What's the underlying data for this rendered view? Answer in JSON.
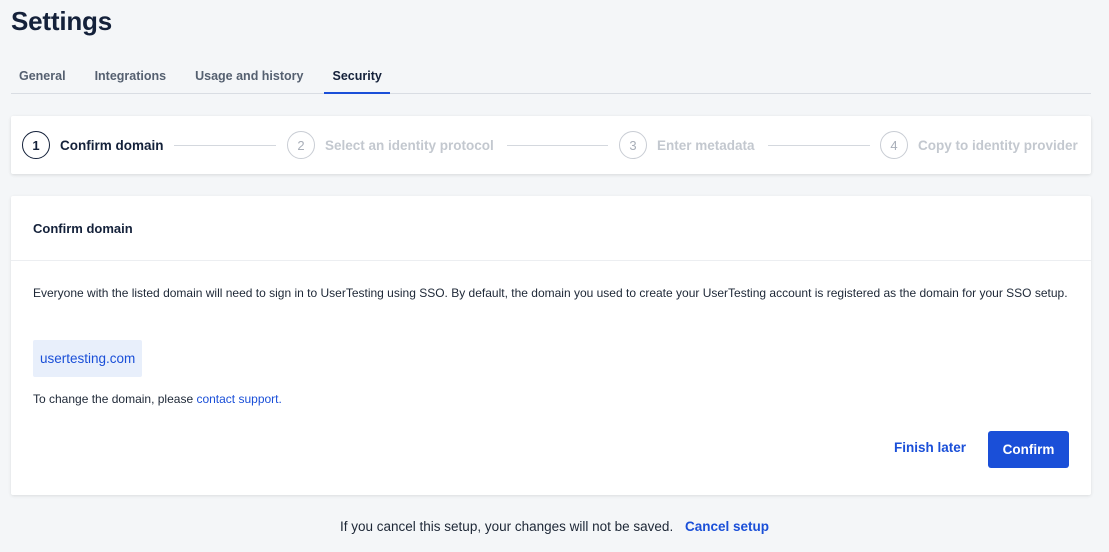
{
  "header": {
    "title": "Settings"
  },
  "tabs": [
    {
      "label": "General"
    },
    {
      "label": "Integrations"
    },
    {
      "label": "Usage and history"
    },
    {
      "label": "Security"
    }
  ],
  "stepper": {
    "steps": [
      {
        "number": "1",
        "label": "Confirm domain"
      },
      {
        "number": "2",
        "label": "Select an identity protocol"
      },
      {
        "number": "3",
        "label": "Enter metadata"
      },
      {
        "number": "4",
        "label": "Copy to identity provider"
      }
    ]
  },
  "card": {
    "title": "Confirm domain",
    "description": "Everyone with the listed domain will need to sign in to UserTesting using SSO. By default, the domain you used to create your UserTesting account is registered as the domain for your SSO setup.",
    "domain": "usertesting.com",
    "change_note": "To change the domain, please",
    "contact_link": "contact support.",
    "finish_later_label": "Finish later",
    "confirm_label": "Confirm"
  },
  "footer": {
    "note": "If you cancel this setup, your changes will not be saved.",
    "cancel_label": "Cancel setup"
  },
  "colors": {
    "accent": "#1a4fd8",
    "background": "#f4f6f8",
    "title": "#14213a"
  }
}
